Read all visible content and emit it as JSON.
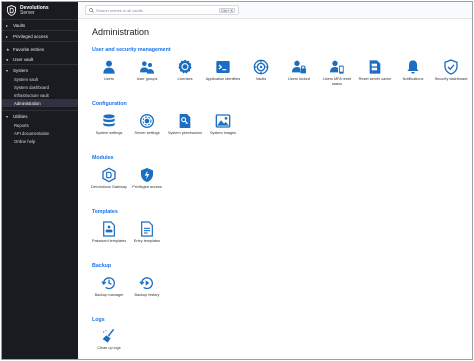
{
  "app": {
    "brand_line1": "Devolutions",
    "brand_line2": "Server"
  },
  "sidebar": {
    "groups": [
      {
        "label": "Vaults"
      },
      {
        "label": "Privileged access"
      },
      {
        "label": "Favorite entries"
      },
      {
        "label": "User vault"
      },
      {
        "label": "System"
      },
      {
        "label": "Utilities"
      }
    ],
    "system_items": [
      "System vault",
      "System dashboard",
      "Infrastructure vault",
      "Administration"
    ],
    "utility_items": [
      "Reports",
      "API documentation",
      "Online help"
    ]
  },
  "search": {
    "placeholder": "Search entries in all vaults",
    "shortcut": "Ctrl + K"
  },
  "page": {
    "title": "Administration"
  },
  "sections": {
    "user_security": {
      "title": "User and security management",
      "items": [
        "Users",
        "User groups",
        "Licenses",
        "Application identities",
        "Vaults",
        "Users locked",
        "Users MFA reset status",
        "Reset server cache",
        "Notifications",
        "Security dashboard"
      ]
    },
    "configuration": {
      "title": "Configuration",
      "items": [
        "System settings",
        "Server settings",
        "System permissions",
        "System images"
      ]
    },
    "modules": {
      "title": "Modules",
      "items": [
        "Devolutions Gateway",
        "Privileged access"
      ]
    },
    "templates": {
      "title": "Templates",
      "items": [
        "Password templates",
        "Entry templates"
      ]
    },
    "backup": {
      "title": "Backup",
      "items": [
        "Backup manager",
        "Backup history"
      ]
    },
    "logs": {
      "title": "Logs",
      "items": [
        "Clean up logs"
      ]
    }
  },
  "colors": {
    "sidebar_bg": "#191b21",
    "accent": "#1a73e8",
    "icon_blue": "#1b6ec2"
  }
}
